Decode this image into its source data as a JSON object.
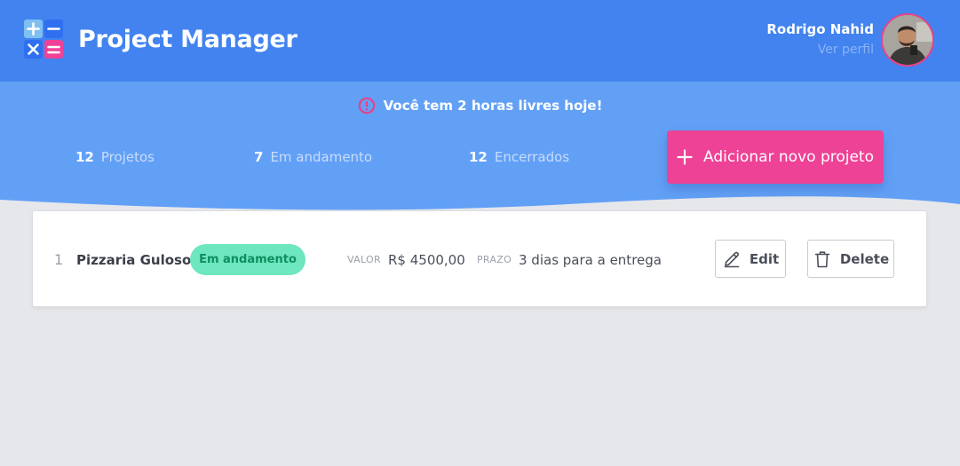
{
  "header": {
    "app_title": "Project Manager",
    "logo_icon": "calculator-logo-icon",
    "user": {
      "name": "Rodrigo Nahid",
      "profile_link": "Ver perfil",
      "avatar": "user-avatar"
    }
  },
  "notice": {
    "icon": "alert-circle-icon",
    "text": "Você tem 2 horas livres hoje!"
  },
  "stats": [
    {
      "count": "12",
      "label": "Projetos"
    },
    {
      "count": "7",
      "label": "Em andamento"
    },
    {
      "count": "12",
      "label": "Encerrados"
    }
  ],
  "add_button": {
    "icon": "plus-icon",
    "label": "Adicionar novo projeto"
  },
  "projects": [
    {
      "index": "1",
      "name": "Pizzaria Guloso",
      "status": "Em andamento",
      "value_label": "VALOR",
      "value": "R$ 4500,00",
      "deadline_label": "PRAZO",
      "deadline": "3 dias para a entrega",
      "edit_label": "Edit",
      "delete_label": "Delete"
    }
  ],
  "colors": {
    "header_bg": "#4283f0",
    "wave_bg": "#62a0f6",
    "accent_pink": "#ee4296",
    "status_bg": "#6ee6bf",
    "status_text": "#0d8f5f",
    "page_bg": "#e6e7eb"
  }
}
